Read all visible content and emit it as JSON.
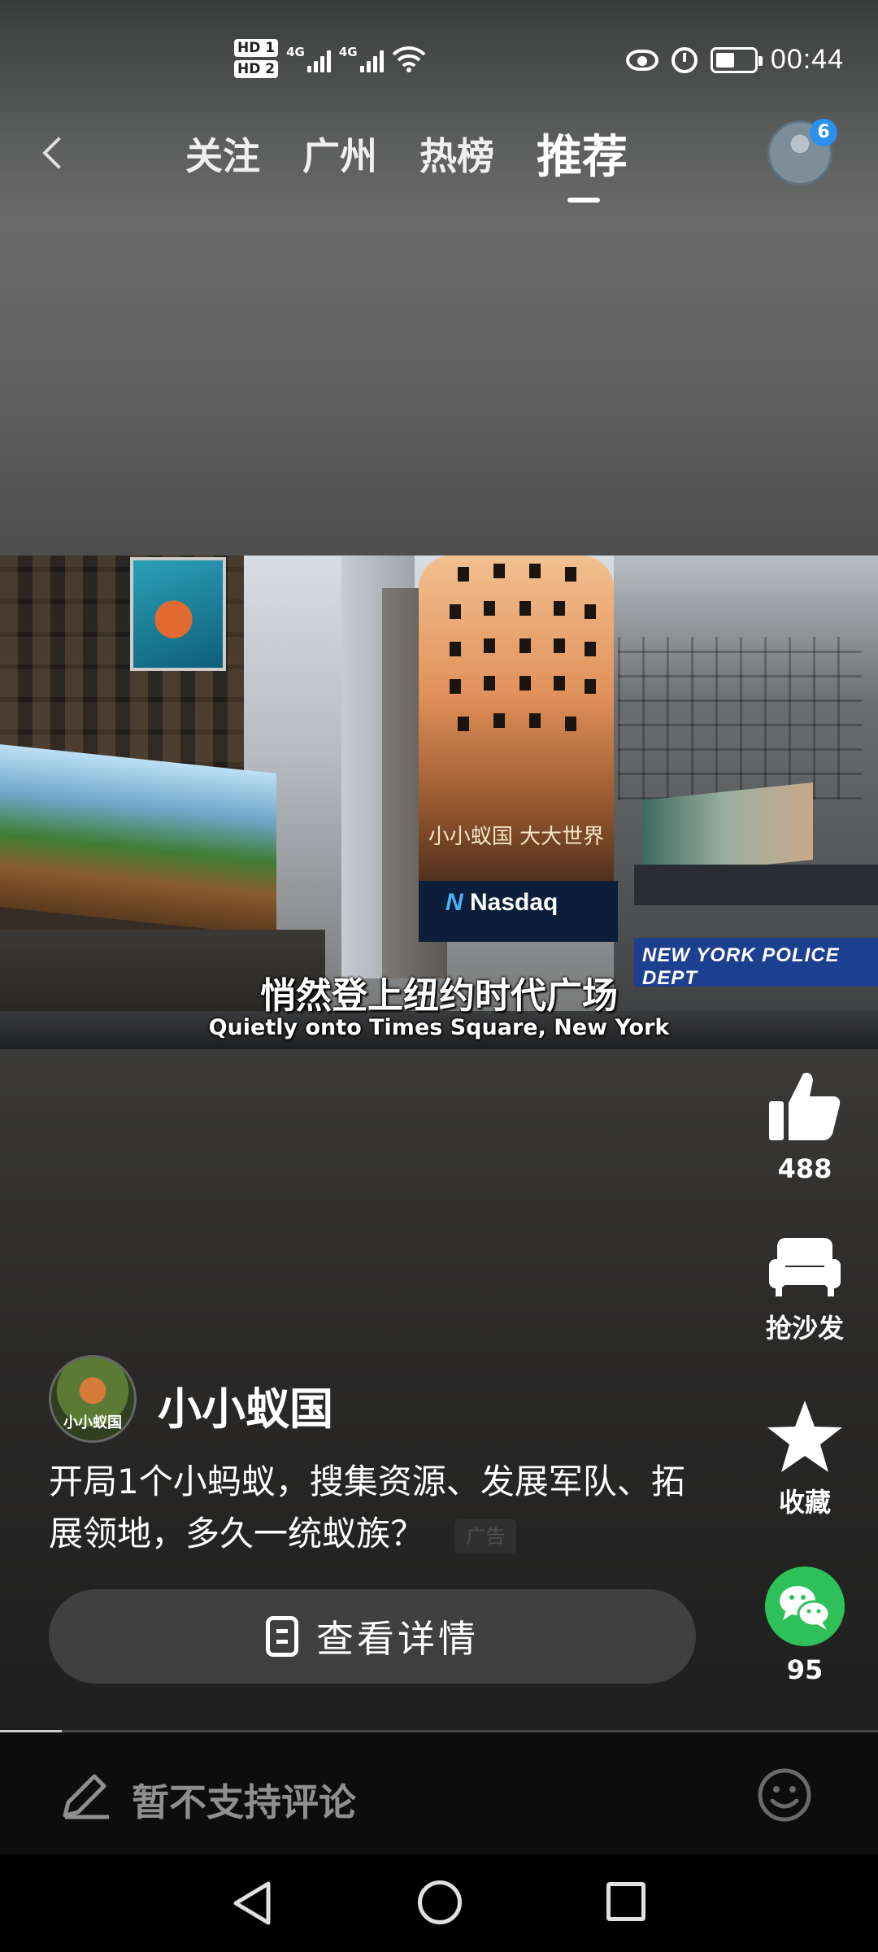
{
  "status_bar": {
    "sim1": "HD 1",
    "sim2": "HD 2",
    "network1": "4G",
    "network2": "4G",
    "time": "00:44"
  },
  "top_nav": {
    "tabs": [
      {
        "label": "关注",
        "active": false
      },
      {
        "label": "广州",
        "active": false
      },
      {
        "label": "热榜",
        "active": false
      },
      {
        "label": "推荐",
        "active": true
      }
    ],
    "notification_count": "6"
  },
  "video": {
    "subtitle_cn": "悄然登上纽约时代广场",
    "subtitle_en": "Quietly onto Times Square, New York",
    "billboard_text": "小小蚁国 大大世界",
    "sign_nasdaq": "Nasdaq",
    "sign_police": "NEW YORK POLICE DEPT",
    "progress": 0.07
  },
  "actions": {
    "like_count": "488",
    "sofa_label": "抢沙发",
    "favorite_label": "收藏",
    "share_count": "95"
  },
  "post": {
    "author_name": "小小蚁国",
    "avatar_text": "小小蚁国",
    "description": "开局1个小蚂蚁，搜集资源、发展军队、拓展领地，多久一统蚁族？",
    "ad_badge": "广告",
    "detail_button": "查看详情"
  },
  "comment_bar": {
    "placeholder": "暂不支持评论"
  },
  "colors": {
    "wechat_green": "#2fc159",
    "badge_blue": "#2b8ff0"
  }
}
